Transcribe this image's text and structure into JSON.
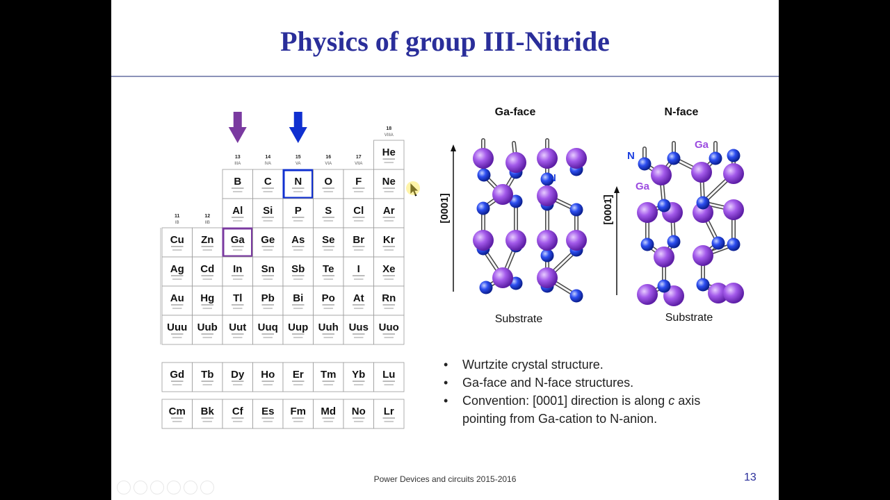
{
  "slide": {
    "title": "Physics of group III-Nitride",
    "footer": "Power Devices and circuits 2015-2016",
    "page_number": "13"
  },
  "periodic_table": {
    "group_headers": [
      {
        "num": "18",
        "roman": "VIIIA"
      },
      {
        "num": "13",
        "roman": "IIIA"
      },
      {
        "num": "14",
        "roman": "IVA"
      },
      {
        "num": "15",
        "roman": "VA"
      },
      {
        "num": "16",
        "roman": "VIA"
      },
      {
        "num": "17",
        "roman": "VIIA"
      },
      {
        "num": "11",
        "roman": "IB"
      },
      {
        "num": "12",
        "roman": "IIB"
      }
    ],
    "rows": [
      [
        "He"
      ],
      [
        "B",
        "C",
        "N",
        "O",
        "F",
        "Ne"
      ],
      [
        "Al",
        "Si",
        "P",
        "S",
        "Cl",
        "Ar"
      ],
      [
        "Cu",
        "Zn",
        "Ga",
        "Ge",
        "As",
        "Se",
        "Br",
        "Kr"
      ],
      [
        "Ag",
        "Cd",
        "In",
        "Sn",
        "Sb",
        "Te",
        "I",
        "Xe"
      ],
      [
        "Au",
        "Hg",
        "Tl",
        "Pb",
        "Bi",
        "Po",
        "At",
        "Rn"
      ],
      [
        "Uuu",
        "Uub",
        "Uut",
        "Uuq",
        "Uup",
        "Uuh",
        "Uus",
        "Uuo"
      ]
    ],
    "lanthanides": [
      "Gd",
      "Tb",
      "Dy",
      "Ho",
      "Er",
      "Tm",
      "Yb",
      "Lu"
    ],
    "actinides": [
      "Cm",
      "Bk",
      "Cf",
      "Es",
      "Fm",
      "Md",
      "No",
      "Lr"
    ],
    "highlight_colors": {
      "Ga": "#7a3aa0",
      "N": "#1030d0"
    }
  },
  "crystal": {
    "ga_face_label": "Ga-face",
    "n_face_label": "N-face",
    "axis_ga": "[0001]",
    "axis_n": "[0001̄]",
    "substrate_label": "Substrate",
    "atom_ga": "Ga",
    "atom_n": "N",
    "colors": {
      "ga": "#9b4be0",
      "n": "#1a3ee0",
      "ga_label": "#9b4be0",
      "n_label": "#1a3ee0"
    }
  },
  "bullets": [
    {
      "text": "Wurtzite crystal structure."
    },
    {
      "text": "Ga-face and N-face  structures."
    },
    {
      "pre": "Convention: [0001] direction is along ",
      "ital": "c",
      "post": " axis",
      "line2": "pointing from Ga-cation to N-anion."
    }
  ],
  "colors": {
    "title": "#2a2e9a",
    "bullet": "#222222"
  }
}
